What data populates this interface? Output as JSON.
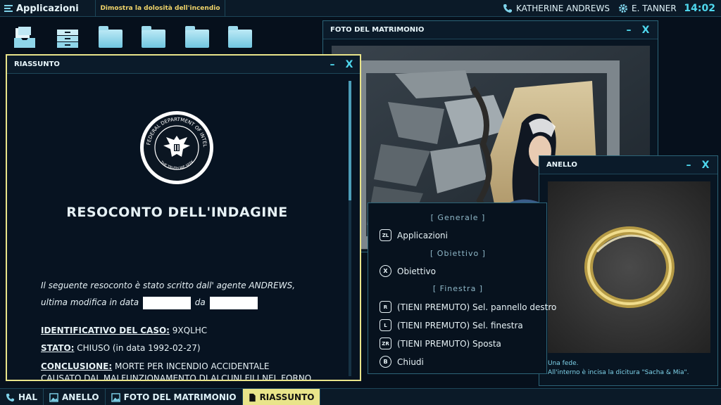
{
  "topbar": {
    "apps_label": "Applicazioni",
    "objective": "Dimostra la dolosità dell'incendio",
    "user1": "KATHERINE ANDREWS",
    "user2": "E. TANNER",
    "clock": "14:02"
  },
  "desktop_icons": [
    "inbox-tray-icon",
    "file-cabinet-icon",
    "folder-icon",
    "folder-icon",
    "folder-icon",
    "folder-icon"
  ],
  "windows": {
    "riassunto": {
      "title": "RIASSUNTO",
      "seal_text": "FEDERAL DEPARTMENT OF INTELLIGENCE",
      "seal_motto": "THE TRUTH WE SEEK",
      "doc_title": "RESOCONTO DELL'INDAGINE",
      "intro_line1": "Il seguente resoconto è stato scritto dall' agente ANDREWS,",
      "intro_line2_a": "ultima modifica in data",
      "intro_line2_b": "da",
      "case_id_label": "IDENTIFICATIVO DEL CASO:",
      "case_id_value": "9XQLHC",
      "status_label": "STATO:",
      "status_value": "CHIUSO (in data 1992-02-27)",
      "conclusion_label": "CONCLUSIONE:",
      "conclusion_value": "MORTE PER INCENDIO ACCIDENTALE",
      "conclusion_line2": "CAUSATO DAL MALFUNZIONAMENTO DI ALCUNI FILI NEL FORNO"
    },
    "foto": {
      "title": "FOTO DEL MATRIMONIO"
    },
    "anello": {
      "title": "ANELLO",
      "caption1": "Una fede.",
      "caption2": "All'interno è incisa la dicitura \"Sacha & Mia\"."
    },
    "controls": {
      "minimize": "–",
      "close": "X"
    }
  },
  "menu": {
    "sections": [
      "[ Generale ]",
      "[ Obiettivo ]",
      "[ Finestra ]"
    ],
    "items": [
      {
        "glyph": "ZL",
        "label": "Applicazioni"
      },
      {
        "glyph": "X",
        "label": "Obiettivo"
      },
      {
        "glyph": "R",
        "label": "(TIENI PREMUTO) Sel. pannello destro"
      },
      {
        "glyph": "L",
        "label": "(TIENI PREMUTO) Sel. finestra"
      },
      {
        "glyph": "ZR",
        "label": "(TIENI PREMUTO) Sposta"
      },
      {
        "glyph": "B",
        "label": "Chiudi"
      }
    ]
  },
  "taskbar": [
    {
      "icon": "phone-icon",
      "label": "HAL"
    },
    {
      "icon": "image-icon",
      "label": "ANELLO"
    },
    {
      "icon": "image-icon",
      "label": "FOTO DEL MATRIMONIO"
    },
    {
      "icon": "document-icon",
      "label": "RIASSUNTO"
    }
  ],
  "colors": {
    "accent": "#4fd8ee",
    "highlight": "#e9e48a",
    "objective": "#f0d46a"
  }
}
